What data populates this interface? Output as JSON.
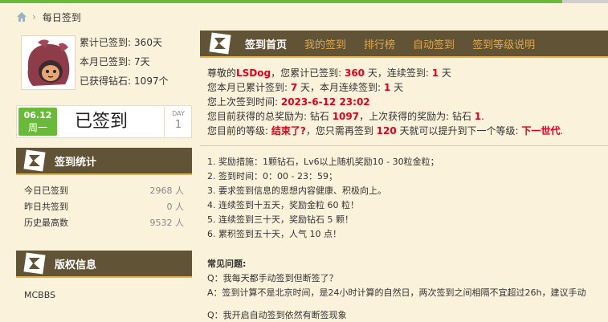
{
  "breadcrumb": {
    "page": "每日签到"
  },
  "user": {
    "total_label": "累计已签到:",
    "total_value": "360天",
    "month_label": "本月已签到:",
    "month_value": "7天",
    "diamond_label": "已获得钻石:",
    "diamond_value": "1097个"
  },
  "sign": {
    "date": "06.12",
    "weekday": "周一",
    "status": "已签到",
    "day_label": "DAY",
    "day_value": "1"
  },
  "stats": {
    "title": "签到统计",
    "rows": [
      {
        "label": "今日已签到",
        "value": "2968 人"
      },
      {
        "label": "昨日共签到",
        "value": "0 人"
      },
      {
        "label": "历史最高数",
        "value": "9532 人"
      }
    ]
  },
  "copyright": {
    "title": "版权信息",
    "text": "MCBBS"
  },
  "tabs": [
    "签到首页",
    "我的签到",
    "排行榜",
    "自动签到",
    "签到等级说明"
  ],
  "info": {
    "l1_a": "尊敬的",
    "user": "LSDog",
    "l1_b": "，您累计已签到: ",
    "total": "360",
    "l1_c": " 天，连续签到: ",
    "streak": "1",
    "l1_d": " 天",
    "l2_a": "您本月已累计签到: ",
    "month": "7",
    "l2_b": " 天，本月连续签到: ",
    "mstreak": "1",
    "l2_c": " 天",
    "l3_a": "您上次签到时间: ",
    "last_time": "2023-6-12 23:02",
    "l4_a": "您目前获得的总奖励为: 钻石 ",
    "diamonds": "1097",
    "l4_b": "，上次获得的奖励为: 钻石 ",
    "last_reward": "1",
    "l4_c": ".",
    "l5_a": "您目前的等级: ",
    "level": "结束了?",
    "l5_b": "，您只需再签到 ",
    "need": "120",
    "l5_c": " 天就可以提升到下一个等级: ",
    "next": "下一世代",
    "l5_d": "."
  },
  "rules": [
    "1. 奖励措施：1颗钻石，Lv6以上随机奖励10 - 30粒金粒；",
    "2. 签到时间：0：00 - 23：59；",
    "3. 要求签到信息的思想内容健康、积极向上。",
    "4. 连续签到十五天，奖励金粒 60 粒！",
    "5. 连续签到三十天，奖励钻石 5 颗！",
    "6. 累积签到五十天，人气 10 点！"
  ],
  "faq": {
    "title": "常见问题:",
    "q1": "Q：我每天都手动签到但断签了？",
    "a1": "A：签到计算不是北京时间，是24小时计算的自然日，两次签到之间相隔不宜超过26h，建议手动",
    "q2": "Q：我开启自动签到依然有断签现象"
  },
  "colors": {
    "accent_green": "#6aba39",
    "header_brown": "#615335",
    "highlight_red": "#e0001a",
    "tab_orange": "#e0a74a"
  }
}
